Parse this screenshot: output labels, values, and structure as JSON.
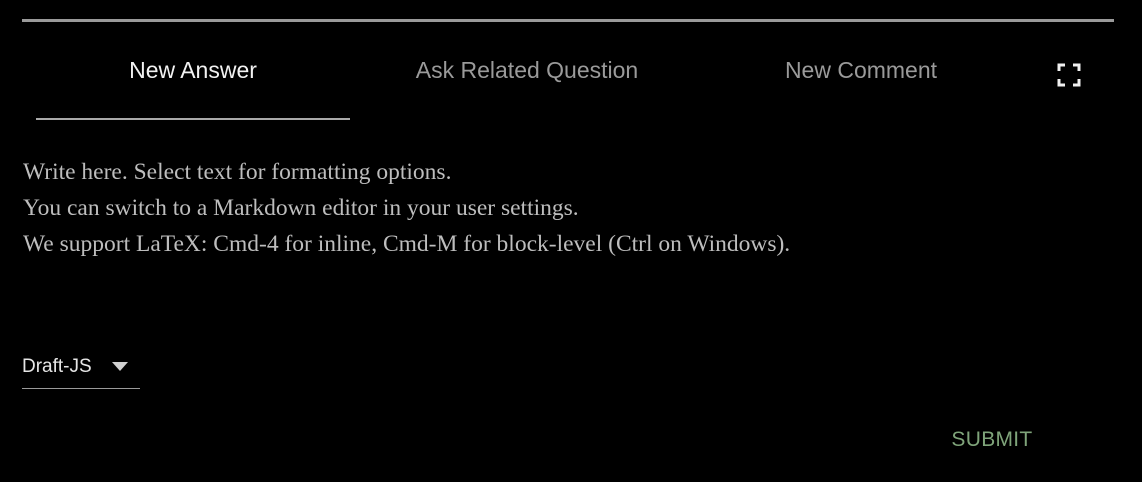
{
  "tabs": [
    {
      "label": "New Answer",
      "active": true
    },
    {
      "label": "Ask Related Question",
      "active": false
    },
    {
      "label": "New Comment",
      "active": false
    }
  ],
  "toolbar": {
    "expand_icon": "expand-fullscreen-icon"
  },
  "editor": {
    "placeholder_lines": [
      "Write here. Select text for formatting options.",
      "You can switch to a Markdown editor in your user settings.",
      "We support LaTeX: Cmd-4 for inline, Cmd-M for block-level (Ctrl on Windows)."
    ]
  },
  "editor_type_select": {
    "value": "Draft-JS",
    "icon": "caret-down-icon"
  },
  "submit": {
    "label": "SUBMIT",
    "color": "#7fa47a"
  },
  "colors": {
    "background": "#000000",
    "active_tab": "#f2f2f2",
    "inactive_tab": "#9a9a9a",
    "accent_submit": "#7fa47a"
  }
}
